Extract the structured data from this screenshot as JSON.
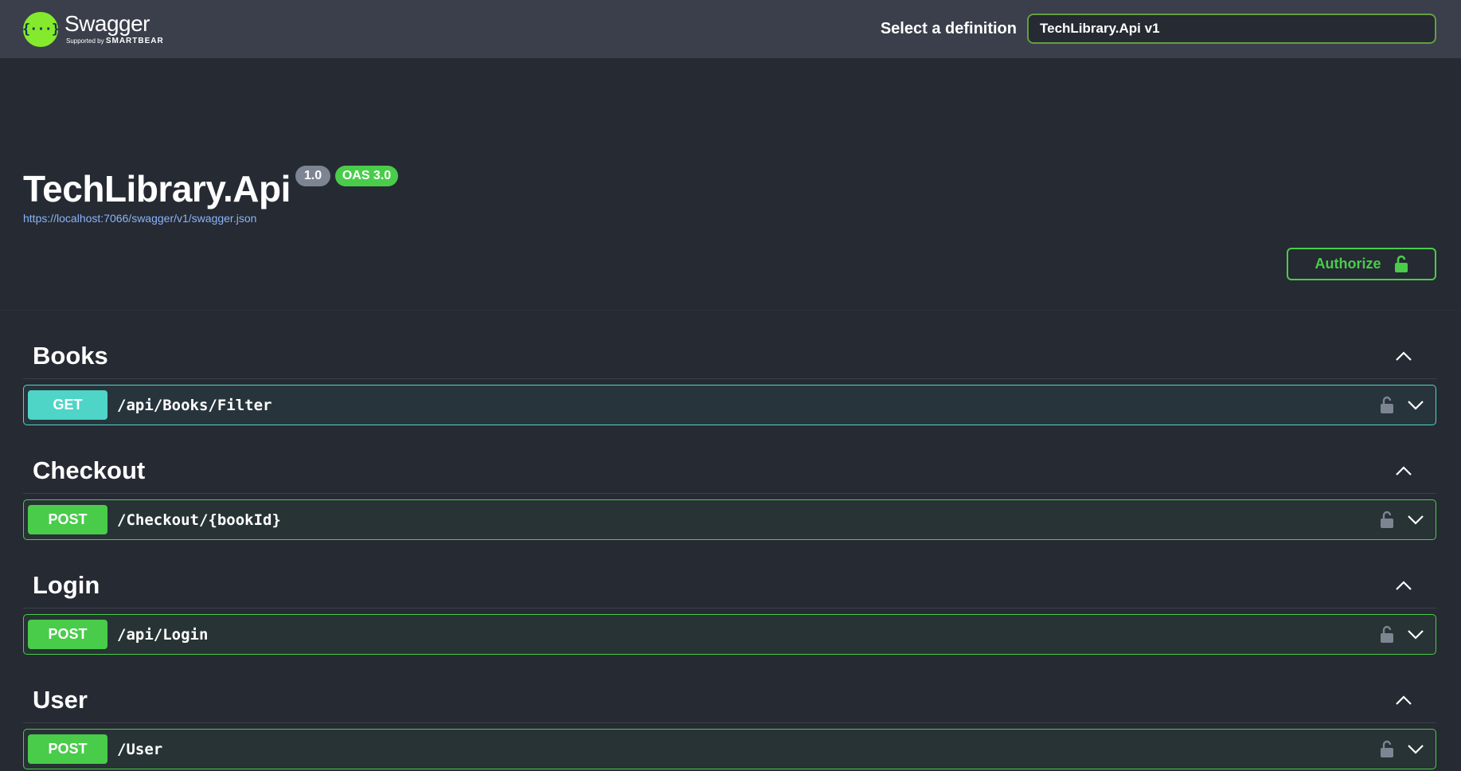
{
  "topbar": {
    "brand_name": "Swagger",
    "brand_sub_prefix": "Supported by",
    "brand_sub_company": "SMARTBEAR",
    "definition_label": "Select a definition",
    "definition_value": "TechLibrary.Api v1"
  },
  "info": {
    "title": "TechLibrary.Api",
    "version": "1.0",
    "oas": "OAS 3.0",
    "spec_url": "https://localhost:7066/swagger/v1/swagger.json",
    "authorize_label": "Authorize"
  },
  "colors": {
    "get": "#4ed5c8",
    "post": "#49cc4a",
    "brand": "#85ea2d",
    "background": "#262a33"
  },
  "tags": [
    {
      "name": "Books",
      "method": "GET",
      "path": "/api/Books/Filter"
    },
    {
      "name": "Checkout",
      "method": "POST",
      "path": "/Checkout/{bookId}"
    },
    {
      "name": "Login",
      "method": "POST",
      "path": "/api/Login"
    },
    {
      "name": "User",
      "method": "POST",
      "path": "/User"
    }
  ],
  "icons": {
    "logo": "swagger-logo-icon",
    "authorize_lock": "unlocked-lock-icon",
    "op_lock": "unlocked-lock-icon",
    "tag_toggle": "chevron-up-icon",
    "op_toggle": "chevron-down-icon"
  }
}
